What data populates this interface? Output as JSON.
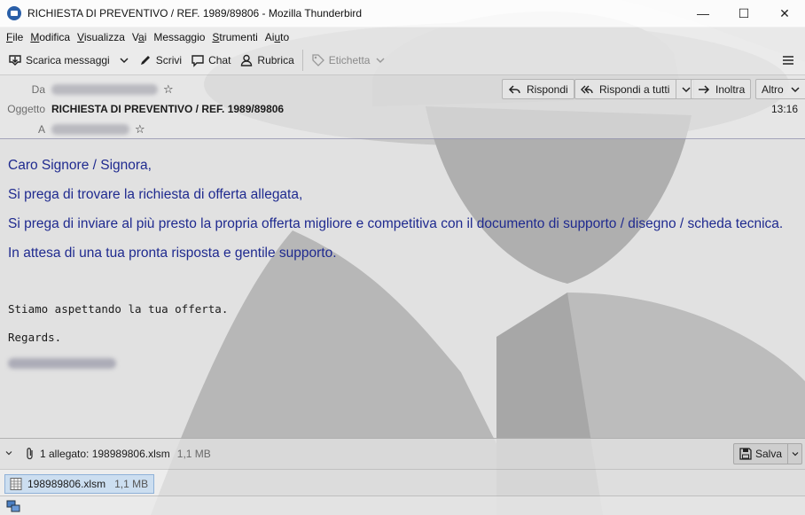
{
  "window": {
    "title": "RICHIESTA DI PREVENTIVO / REF. 1989/89806 - Mozilla Thunderbird",
    "minimize": "—",
    "maximize": "☐",
    "close": "✕"
  },
  "menu": {
    "items": [
      {
        "label": "File",
        "accel": "F",
        "rest": "ile"
      },
      {
        "label": "Modifica",
        "accel": "M",
        "rest": "odifica"
      },
      {
        "label": "Visualizza",
        "accel": "V",
        "rest": "isualizza"
      },
      {
        "label": "Vai",
        "pre": "V",
        "accel": "a",
        "rest": "i"
      },
      {
        "label": "Messaggio",
        "pre": "Messa",
        "accel": "g",
        "rest": "gio"
      },
      {
        "label": "Strumenti",
        "accel": "S",
        "rest": "trumenti"
      },
      {
        "label": "Aiuto",
        "pre": "Ai",
        "accel": "u",
        "rest": "to"
      }
    ]
  },
  "toolbar": {
    "get_messages": "Scarica messaggi",
    "write": "Scrivi",
    "chat": "Chat",
    "address_book": "Rubrica",
    "tag": "Etichetta"
  },
  "header": {
    "from_label": "Da",
    "subject_label": "Oggetto",
    "subject": "RICHIESTA DI PREVENTIVO / REF. 1989/89806",
    "to_label": "A",
    "time": "13:16",
    "reply": "Rispondi",
    "reply_all": "Rispondi a tutti",
    "forward": "Inoltra",
    "more": "Altro"
  },
  "message": {
    "greeting": "Caro Signore / Signora,",
    "p1": "Si prega di trovare la richiesta di offerta allegata,",
    "p2": "Si prega di inviare al più presto la propria offerta migliore e competitiva con il documento di supporto / disegno / scheda tecnica.",
    "p3": "In attesa di una tua pronta risposta e gentile supporto.",
    "closing1": "Stiamo aspettando la tua offerta.",
    "closing2": "Regards."
  },
  "attachments": {
    "summary": "1 allegato: 198989806.xlsm",
    "total_size": "1,1 MB",
    "save": "Salva",
    "items": [
      {
        "name": "198989806.xlsm",
        "size": "1,1 MB"
      }
    ]
  },
  "colors": {
    "message_text": "#1f2a8f",
    "attachment_selected": "#c8dcf0"
  }
}
